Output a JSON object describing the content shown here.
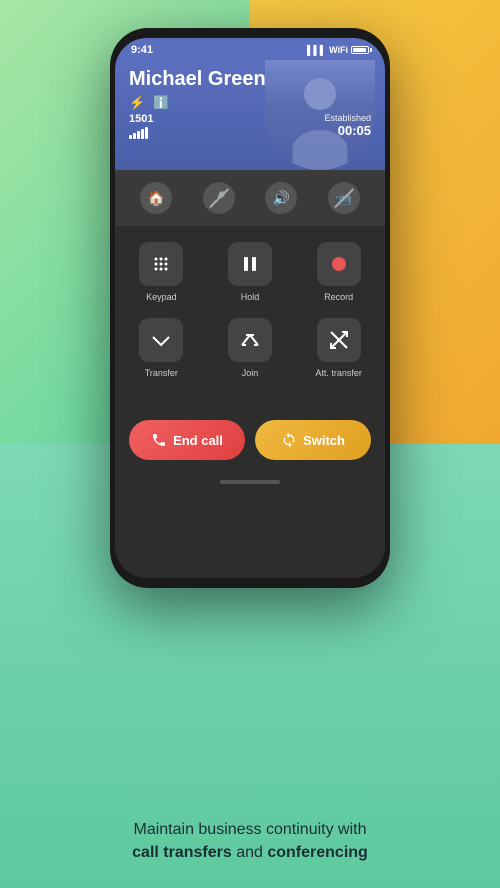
{
  "background": {
    "top_left_color": "#a8e6a3",
    "top_right_color": "#f5c842",
    "bottom_color": "#7dd8b5"
  },
  "status_bar": {
    "time": "9:41",
    "battery": "100"
  },
  "call_header": {
    "caller_name": "Michael Green",
    "caller_number": "1501",
    "established_label": "Established",
    "call_duration": "00:05"
  },
  "action_buttons": [
    {
      "id": "home",
      "label": "Home",
      "icon": "🏠"
    },
    {
      "id": "mute",
      "label": "Mute",
      "icon": "🎤",
      "strikethrough": true
    },
    {
      "id": "speaker",
      "label": "Speaker",
      "icon": "🔊"
    },
    {
      "id": "video-off",
      "label": "Video off",
      "icon": "📷",
      "strikethrough": true
    }
  ],
  "controls": [
    {
      "id": "keypad",
      "label": "Keypad",
      "type": "keypad"
    },
    {
      "id": "hold",
      "label": "Hold",
      "type": "pause"
    },
    {
      "id": "record",
      "label": "Record",
      "type": "record"
    },
    {
      "id": "transfer",
      "label": "Transfer",
      "type": "transfer"
    },
    {
      "id": "join",
      "label": "Join",
      "type": "join"
    },
    {
      "id": "att-transfer",
      "label": "Att. transfer",
      "type": "att-transfer"
    }
  ],
  "bottom_buttons": {
    "end_call": "End call",
    "switch": "Switch"
  },
  "footer_text": {
    "line1": "Maintain business continuity with",
    "line2_part1": "call transfers",
    "line2_and": " and ",
    "line2_part2": "conferencing"
  }
}
